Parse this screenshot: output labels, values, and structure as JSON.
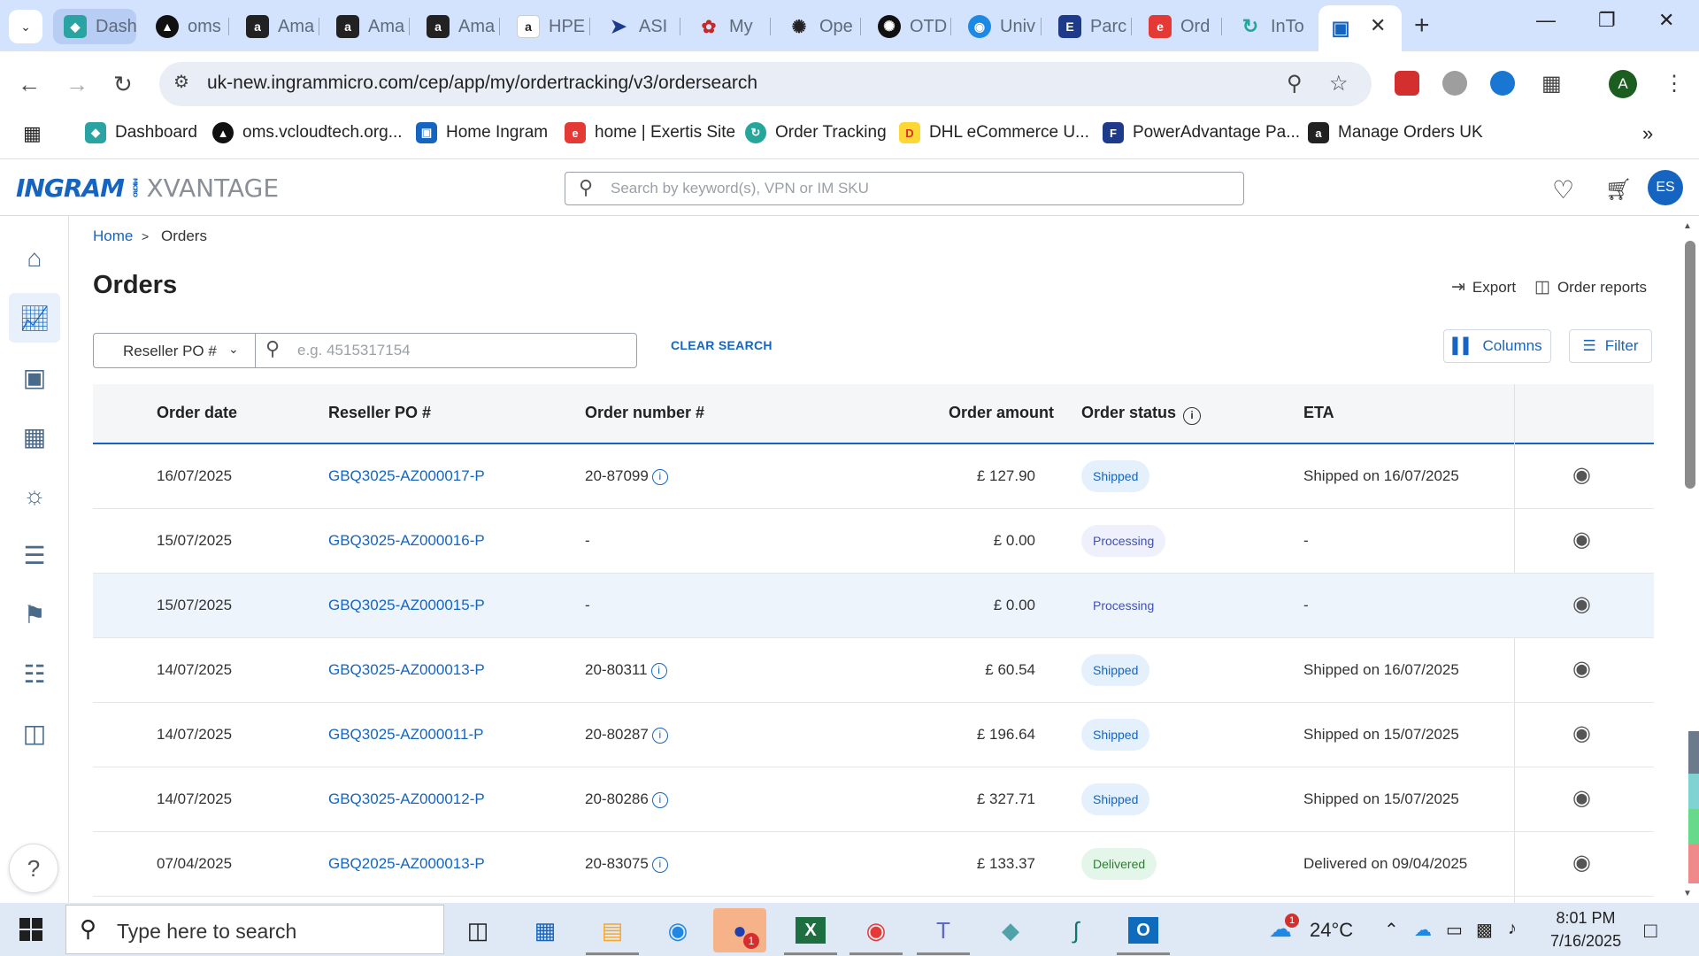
{
  "browser": {
    "tabs": [
      {
        "label": "Dash",
        "icon": "teal-diamond-icon"
      },
      {
        "label": "oms",
        "icon": "black-triangle-icon"
      },
      {
        "label": "Ama",
        "icon": "amazon-icon"
      },
      {
        "label": "Ama",
        "icon": "amazon-icon"
      },
      {
        "label": "Ama",
        "icon": "amazon-icon"
      },
      {
        "label": "HPE",
        "icon": "amazon-icon"
      },
      {
        "label": "ASI",
        "icon": "arrow-icon"
      },
      {
        "label": "My",
        "icon": "red-circles-icon"
      },
      {
        "label": "Ope",
        "icon": "openai-icon"
      },
      {
        "label": "OTD",
        "icon": "openai-icon"
      },
      {
        "label": "Univ",
        "icon": "globe-icon"
      },
      {
        "label": "Parc",
        "icon": "e-icon"
      },
      {
        "label": "Ord",
        "icon": "exertis-icon"
      },
      {
        "label": "InTo",
        "icon": "intouch-icon"
      }
    ],
    "active_tab_icon": "ingram-icon",
    "url": "uk-new.ingrammicro.com/cep/app/my/ordertracking/v3/ordersearch",
    "profile_initial": "A",
    "bookmarks": [
      {
        "label": "Dashboard",
        "color": "#2aa3a3"
      },
      {
        "label": "oms.vcloudtech.org...",
        "color": "#111111"
      },
      {
        "label": "Home Ingram",
        "color": "#1565c0"
      },
      {
        "label": "home | Exertis Site",
        "color": "#e53935"
      },
      {
        "label": "Order Tracking",
        "color": "#26a69a"
      },
      {
        "label": "DHL eCommerce U...",
        "color": "#fdd835"
      },
      {
        "label": "PowerAdvantage Pa...",
        "color": "#1e3a8a"
      },
      {
        "label": "Manage Orders UK",
        "color": "#222222"
      }
    ]
  },
  "app": {
    "logo_main": "INGRAM",
    "logo_micro": "MICRO",
    "logo_sub": "XVANTAGE",
    "search_placeholder": "Search by keyword(s), VPN or IM SKU",
    "user_initials": "ES"
  },
  "breadcrumb": {
    "home": "Home",
    "separator": ">",
    "current": "Orders"
  },
  "page": {
    "title": "Orders",
    "export_label": "Export",
    "reports_label": "Order reports"
  },
  "filters": {
    "field": "Reseller PO #",
    "placeholder": "e.g. 4515317154",
    "clear_label": "CLEAR SEARCH",
    "columns_label": "Columns",
    "filter_label": "Filter"
  },
  "table": {
    "headers": {
      "order_date": "Order date",
      "reseller_po": "Reseller PO #",
      "order_number": "Order number #",
      "order_amount": "Order amount",
      "order_status": "Order status",
      "eta": "ETA"
    },
    "rows": [
      {
        "date": "16/07/2025",
        "po": "GBQ3025-AZ000017-P",
        "order": "20-87099",
        "amount": "£ 127.90",
        "status": "Shipped",
        "eta": "Shipped on 16/07/2025"
      },
      {
        "date": "15/07/2025",
        "po": "GBQ3025-AZ000016-P",
        "order": "-",
        "amount": "£ 0.00",
        "status": "Processing",
        "eta": "-"
      },
      {
        "date": "15/07/2025",
        "po": "GBQ3025-AZ000015-P",
        "order": "-",
        "amount": "£ 0.00",
        "status": "Processing",
        "eta": "-"
      },
      {
        "date": "14/07/2025",
        "po": "GBQ3025-AZ000013-P",
        "order": "20-80311",
        "amount": "£ 60.54",
        "status": "Shipped",
        "eta": "Shipped on 16/07/2025"
      },
      {
        "date": "14/07/2025",
        "po": "GBQ3025-AZ000011-P",
        "order": "20-80287",
        "amount": "£ 196.64",
        "status": "Shipped",
        "eta": "Shipped on 15/07/2025"
      },
      {
        "date": "14/07/2025",
        "po": "GBQ3025-AZ000012-P",
        "order": "20-80286",
        "amount": "£ 327.71",
        "status": "Shipped",
        "eta": "Shipped on 15/07/2025"
      },
      {
        "date": "07/04/2025",
        "po": "GBQ2025-AZ000013-P",
        "order": "20-83075",
        "amount": "£ 133.37",
        "status": "Delivered",
        "eta": "Delivered on 09/04/2025"
      }
    ]
  },
  "taskbar": {
    "search_placeholder": "Type here to search",
    "weather": "24°C",
    "weather_badge": "1",
    "zoom_badge": "1",
    "time": "8:01 PM",
    "date": "7/16/2025"
  }
}
